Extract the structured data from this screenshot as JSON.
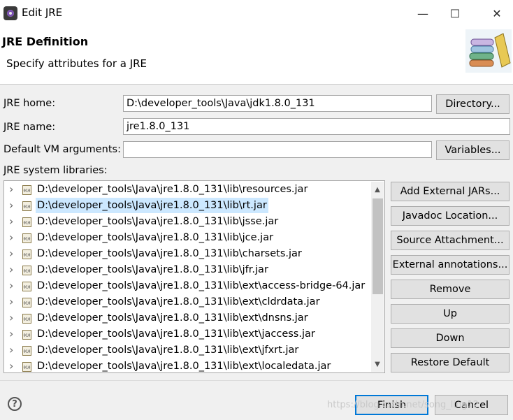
{
  "window": {
    "title": "Edit JRE",
    "minimize": "—",
    "maximize": "☐",
    "close": "✕"
  },
  "header": {
    "title": "JRE Definition",
    "subtitle": "Specify attributes for a JRE"
  },
  "form": {
    "jre_home_label": "JRE home:",
    "jre_home_value": "D:\\developer_tools\\Java\\jdk1.8.0_131",
    "directory_button": "Directory...",
    "jre_name_label": "JRE name:",
    "jre_name_value": "jre1.8.0_131",
    "vm_args_label": "Default VM arguments:",
    "vm_args_value": "",
    "variables_button": "Variables...",
    "libraries_label": "JRE system libraries:"
  },
  "libraries": [
    "D:\\developer_tools\\Java\\jre1.8.0_131\\lib\\resources.jar",
    "D:\\developer_tools\\Java\\jre1.8.0_131\\lib\\rt.jar",
    "D:\\developer_tools\\Java\\jre1.8.0_131\\lib\\jsse.jar",
    "D:\\developer_tools\\Java\\jre1.8.0_131\\lib\\jce.jar",
    "D:\\developer_tools\\Java\\jre1.8.0_131\\lib\\charsets.jar",
    "D:\\developer_tools\\Java\\jre1.8.0_131\\lib\\jfr.jar",
    "D:\\developer_tools\\Java\\jre1.8.0_131\\lib\\ext\\access-bridge-64.jar",
    "D:\\developer_tools\\Java\\jre1.8.0_131\\lib\\ext\\cldrdata.jar",
    "D:\\developer_tools\\Java\\jre1.8.0_131\\lib\\ext\\dnsns.jar",
    "D:\\developer_tools\\Java\\jre1.8.0_131\\lib\\ext\\jaccess.jar",
    "D:\\developer_tools\\Java\\jre1.8.0_131\\lib\\ext\\jfxrt.jar",
    "D:\\developer_tools\\Java\\jre1.8.0_131\\lib\\ext\\localedata.jar"
  ],
  "selected_library_index": 1,
  "side_buttons": {
    "add_external_jars": "Add External JARs...",
    "javadoc_location": "Javadoc Location...",
    "source_attachment": "Source Attachment...",
    "external_annotations": "External annotations...",
    "remove": "Remove",
    "up": "Up",
    "down": "Down",
    "restore_default": "Restore Default"
  },
  "footer": {
    "help": "?",
    "finish": "Finish",
    "cancel": "Cancel",
    "watermark": "https://blog.csdn.net/song_ling12"
  },
  "colors": {
    "selection": "#cce8ff",
    "default_button_border": "#0078d7"
  },
  "icons": {
    "app": "eclipse-icon",
    "header": "books-icon",
    "library": "jar-icon",
    "expand": "chevron-right-icon"
  }
}
